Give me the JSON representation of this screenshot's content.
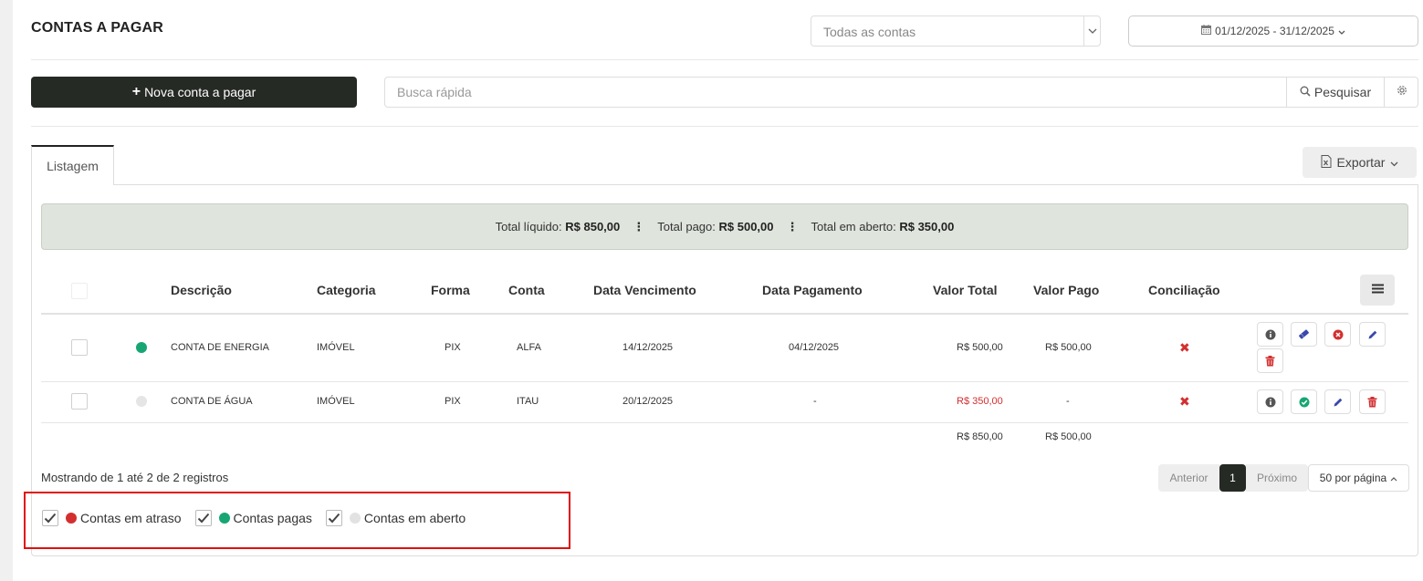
{
  "header": {
    "title": "CONTAS A PAGAR",
    "account_select": "Todas as contas",
    "date_range": "01/12/2025 - 31/12/2025"
  },
  "toolbar": {
    "new_button": "Nova conta a pagar",
    "search_placeholder": "Busca rápida",
    "search_button": "Pesquisar"
  },
  "tabs": {
    "listagem": "Listagem"
  },
  "export_label": "Exportar",
  "totals": {
    "liquido_label": "Total líquido:",
    "liquido_value": "R$ 850,00",
    "pago_label": "Total pago:",
    "pago_value": "R$ 500,00",
    "aberto_label": "Total em aberto:",
    "aberto_value": "R$ 350,00"
  },
  "columns": {
    "descricao": "Descrição",
    "categoria": "Categoria",
    "forma": "Forma",
    "conta": "Conta",
    "vencimento": "Data Vencimento",
    "pagamento": "Data Pagamento",
    "valor_total": "Valor Total",
    "valor_pago": "Valor Pago",
    "conciliacao": "Conciliação"
  },
  "rows": [
    {
      "status_color": "#17a673",
      "descricao": "CONTA DE ENERGIA",
      "categoria": "IMÓVEL",
      "forma": "PIX",
      "conta": "ALFA",
      "vencimento": "14/12/2025",
      "pagamento": "04/12/2025",
      "valor_total": "R$ 500,00",
      "valor_pago": "R$ 500,00",
      "conciliacao": "✖"
    },
    {
      "status_color": "#e5e5e5",
      "descricao": "CONTA DE ÁGUA",
      "categoria": "IMÓVEL",
      "forma": "PIX",
      "conta": "ITAU",
      "vencimento": "20/12/2025",
      "pagamento": "-",
      "valor_total": "R$ 350,00",
      "valor_pago": "-",
      "conciliacao": "✖"
    }
  ],
  "footer_totals": {
    "valor_total": "R$ 850,00",
    "valor_pago": "R$ 500,00"
  },
  "info_text": "Mostrando de 1 até 2 de 2 registros",
  "pagination": {
    "prev": "Anterior",
    "current": "1",
    "next": "Próximo",
    "page_size": "50 por página"
  },
  "legend": [
    {
      "label": "Contas em atraso",
      "color": "#d32f2f",
      "checked": true
    },
    {
      "label": "Contas pagas",
      "color": "#17a673",
      "checked": true
    },
    {
      "label": "Contas em aberto",
      "color": "#e2e2e2",
      "checked": true
    }
  ],
  "colors": {
    "dark_button": "#262a25",
    "overdue_value": "#d32f2f",
    "highlight_border": "#e01010"
  }
}
